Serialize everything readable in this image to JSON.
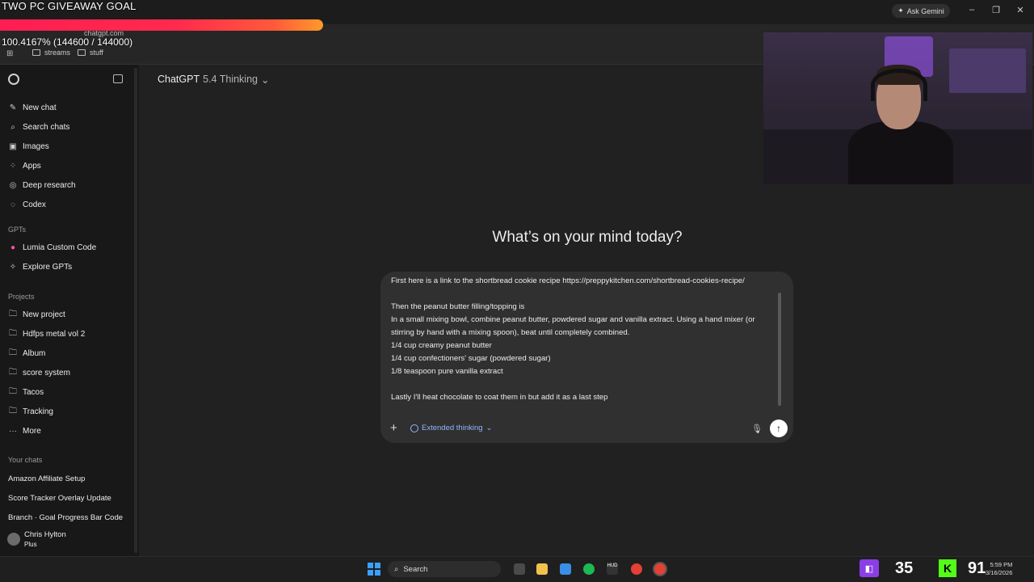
{
  "browser": {
    "tab_title": "ChatGPT",
    "url": "chatgpt.com",
    "ask_gemini": "Ask Gemini",
    "bookmarks": [
      "streams",
      "stuff"
    ]
  },
  "overlay": {
    "goal_title": "TWO PC GIVEAWAY GOAL",
    "goal_text": "100.4167% (144600 / 144000)",
    "goal_progress_percent": 100.4167
  },
  "sidebar": {
    "nav": [
      {
        "label": "New chat",
        "icon": "compose-icon"
      },
      {
        "label": "Search chats",
        "icon": "search-icon"
      },
      {
        "label": "Images",
        "icon": "image-icon"
      },
      {
        "label": "Apps",
        "icon": "apps-icon"
      },
      {
        "label": "Deep research",
        "icon": "research-icon"
      },
      {
        "label": "Codex",
        "icon": "codex-icon"
      }
    ],
    "gpts_heading": "GPTs",
    "gpts": [
      {
        "label": "Lumia Custom Code",
        "icon": "lumia-icon"
      },
      {
        "label": "Explore GPTs",
        "icon": "explore-icon"
      }
    ],
    "projects_heading": "Projects",
    "projects": [
      {
        "label": "New project",
        "icon": "folder-plus-icon"
      },
      {
        "label": "Hdfps metal vol 2",
        "icon": "folder-icon"
      },
      {
        "label": "Album",
        "icon": "folder-icon"
      },
      {
        "label": "score system",
        "icon": "folder-icon"
      },
      {
        "label": "Tacos",
        "icon": "folder-icon"
      },
      {
        "label": "Tracking",
        "icon": "folder-icon"
      },
      {
        "label": "More",
        "icon": "more-icon"
      }
    ],
    "chats_heading": "Your chats",
    "chats": [
      "Amazon Affiliate Setup",
      "Score Tracker Overlay Update",
      "Branch · Goal Progress Bar Code"
    ],
    "user": {
      "name": "Chris Hylton",
      "plan": "Plus"
    }
  },
  "main": {
    "model_name": "ChatGPT",
    "model_version": "5.4 Thinking",
    "headline": "What’s on your mind today?",
    "composer_text": "First here is a link to the shortbread cookie recipe https://preppykitchen.com/shortbread-cookies-recipe/\n\nThen the peanut butter filling/topping is\nIn a small mixing bowl, combine peanut butter, powdered sugar and vanilla extract. Using a hand mixer (or stirring by hand with a mixing spoon), beat until completely combined.\n1/4 cup creamy peanut butter\n1/4 cup confectioners' sugar (powdered sugar)\n1/8 teaspoon pure vanilla extract\n\nLastly I'll heat chocolate to coat them in but add it as a last step",
    "extended_thinking": "Extended thinking"
  },
  "taskbar": {
    "search": "Search",
    "twitch_count": "35",
    "kick_count": "91",
    "time": "5:59 PM",
    "date": "3/16/2026"
  }
}
